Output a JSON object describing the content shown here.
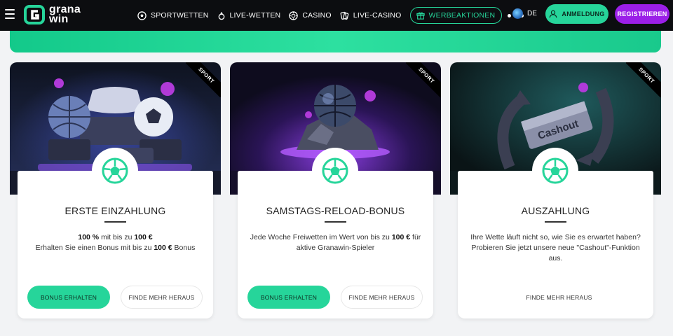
{
  "brand": {
    "logo_line1": "grana",
    "logo_line2": "win"
  },
  "nav": {
    "items": [
      {
        "label": "SPORTWETTEN",
        "icon": "soccer-ball-icon"
      },
      {
        "label": "LIVE-WETTEN",
        "icon": "live-icon"
      },
      {
        "label": "CASINO",
        "icon": "chip-icon"
      },
      {
        "label": "LIVE-CASINO",
        "icon": "cards-icon"
      },
      {
        "label": "WERBEAKTIONEN",
        "icon": "gift-icon"
      }
    ],
    "language": "DE",
    "login_label": "ANMELDUNG",
    "register_label": "REGISTRIEREN"
  },
  "colors": {
    "accent": "#26d59a",
    "register": "#9b1fe8",
    "topbar": "#0c0d10"
  },
  "cards": [
    {
      "ribbon": "SPORT",
      "title": "ERSTE EINZAHLUNG",
      "line1_b1": "100 %",
      "line1_t1": " mit bis zu ",
      "line1_b2": "100 €",
      "line2_t1": "Erhalten Sie einen Bonus mit bis zu ",
      "line2_b1": "100 €",
      "line2_t2": " Bonus",
      "primary_label": "BONUS ERHALTEN",
      "secondary_label": "FINDE MEHR HERAUS"
    },
    {
      "ribbon": "SPORT",
      "title": "SAMSTAGS-RELOAD-BONUS",
      "t1": "Jede Woche Freiwetten im Wert von bis zu ",
      "b1": "100 €",
      "t2": " für aktive Granawin-Spieler",
      "primary_label": "BONUS ERHALTEN",
      "secondary_label": "FINDE MEHR HERAUS"
    },
    {
      "ribbon": "SPORT",
      "title": "AUSZAHLUNG",
      "text": "Ihre Wette läuft nicht so, wie Sie es erwartet haben? Probieren Sie jetzt unsere neue \"Cashout\"-Funktion aus.",
      "image_text": "Cashout",
      "secondary_label": "FINDE MEHR HERAUS"
    }
  ]
}
